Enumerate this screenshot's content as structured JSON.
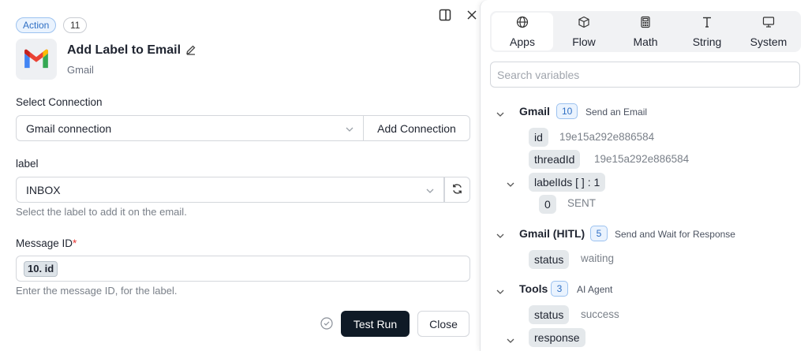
{
  "header": {
    "type_badge": "Action",
    "step_number": "11",
    "title": "Add Label to Email",
    "app_name": "Gmail"
  },
  "connection": {
    "label": "Select Connection",
    "value": "Gmail connection",
    "add_button": "Add Connection"
  },
  "label_field": {
    "label": "label",
    "value": "INBOX",
    "helper": "Select the label to add it on the email."
  },
  "message_id": {
    "label": "Message ID",
    "required_mark": "*",
    "chip": "10. id",
    "helper": "Enter the message ID, for the label."
  },
  "footer": {
    "test_run": "Test Run",
    "close": "Close"
  },
  "variables_panel": {
    "tabs": [
      {
        "label": "Apps",
        "icon": "globe-icon",
        "active": true
      },
      {
        "label": "Flow",
        "icon": "cube-icon",
        "active": false
      },
      {
        "label": "Math",
        "icon": "calculator-icon",
        "active": false
      },
      {
        "label": "String",
        "icon": "text-icon",
        "active": false
      },
      {
        "label": "System",
        "icon": "monitor-icon",
        "active": false
      }
    ],
    "search_placeholder": "Search variables",
    "groups": [
      {
        "name": "Gmail",
        "step": "10",
        "description": "Send an Email",
        "items": [
          {
            "key": "id",
            "value": "19e15a292e886584"
          },
          {
            "key": "threadId",
            "value": "19e15a292e886584"
          },
          {
            "key": "labelIds [ ] : 1",
            "value": ""
          },
          {
            "key": "0",
            "value": "SENT"
          }
        ]
      },
      {
        "name": "Gmail (HITL)",
        "step": "5",
        "description": "Send and Wait for Response",
        "items": [
          {
            "key": "status",
            "value": "waiting"
          }
        ]
      },
      {
        "name": "Tools",
        "step": "3",
        "description": "AI Agent",
        "items": [
          {
            "key": "status",
            "value": "success"
          },
          {
            "key": "response",
            "value": ""
          }
        ]
      }
    ]
  },
  "colors": {
    "primary_button": "#0f1a26",
    "badge_blue": "#2f6fc4",
    "required": "#e53935"
  }
}
